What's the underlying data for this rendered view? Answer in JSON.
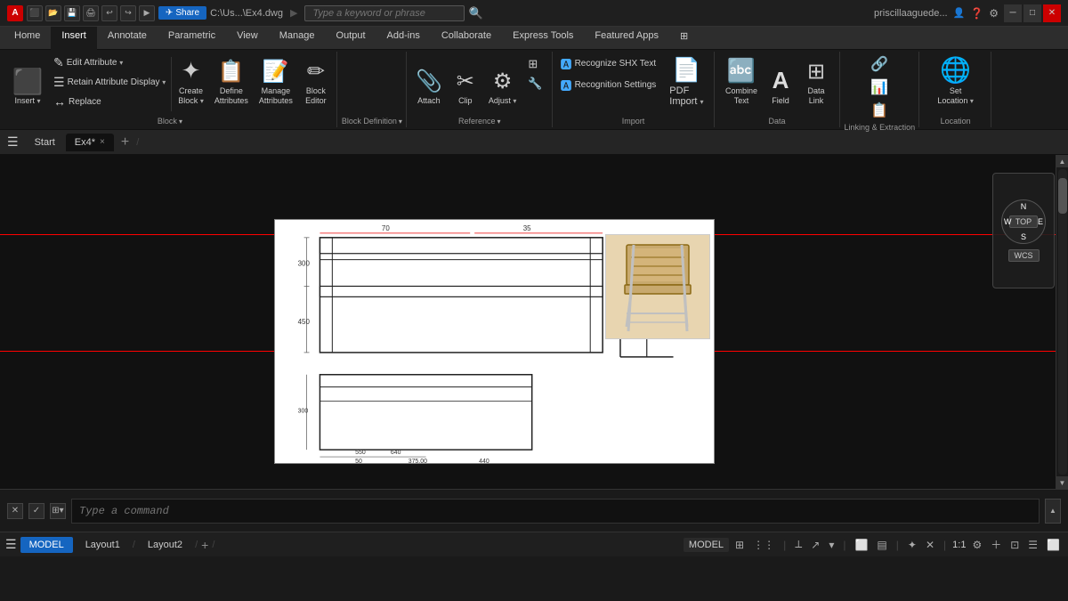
{
  "titlebar": {
    "logo": "A",
    "icons": [
      "⬛",
      "💾",
      "📂",
      "💾",
      "↩",
      "↩",
      "▶",
      "▶"
    ],
    "share_label": "Share",
    "share_icon": "✈",
    "path": "C:\\Us...\\Ex4.dwg",
    "search_placeholder": "Type a keyword or phrase",
    "user": "priscillaaguede...",
    "minimize": "─",
    "maximize": "□",
    "close": "✕"
  },
  "ribbon_tabs": {
    "tabs": [
      "Home",
      "Insert",
      "Annotate",
      "Parametric",
      "View",
      "Manage",
      "Output",
      "Add-ins",
      "Collaborate",
      "Express Tools",
      "Featured Apps",
      "⊞"
    ],
    "active": "Insert"
  },
  "ribbon": {
    "block_group_label": "Block",
    "block_items": [
      {
        "id": "insert",
        "icon": "⬛",
        "label": "Insert",
        "has_dropdown": true
      },
      {
        "id": "create-block",
        "icon": "✦",
        "label": "Create\nBlock",
        "has_dropdown": true
      },
      {
        "id": "define-attrs",
        "icon": "📋",
        "label": "Define\nAttributes"
      },
      {
        "id": "manage-attrs",
        "icon": "📝",
        "label": "Manage\nAttributes"
      },
      {
        "id": "block-editor",
        "icon": "✏",
        "label": "Block\nEditor"
      }
    ],
    "block_small": [
      {
        "id": "edit-attr",
        "icon": "✎",
        "label": "Edit Attribute"
      },
      {
        "id": "retain-attr",
        "icon": "☰",
        "label": "Retain Attribute Display"
      },
      {
        "id": "replace",
        "icon": "↔",
        "label": "Replace"
      }
    ],
    "block_def_label": "Block Definition",
    "reference_group_label": "Reference",
    "reference_items": [
      {
        "id": "attach",
        "icon": "📎",
        "label": "Attach"
      },
      {
        "id": "clip",
        "icon": "✂",
        "label": "Clip"
      },
      {
        "id": "adjust",
        "icon": "⚙",
        "label": "Adjust"
      }
    ],
    "ref_extra_label": "Reference",
    "import_group_label": "Import",
    "import_items": [
      {
        "id": "recognize-shx",
        "icon": "🅰",
        "label": "Recognize SHX Text"
      },
      {
        "id": "recognition-settings",
        "icon": "🅰",
        "label": "Recognition Settings"
      },
      {
        "id": "pdf-import",
        "icon": "📄",
        "label": "PDF\nImport",
        "has_dropdown": true
      }
    ],
    "data_group_label": "Data",
    "data_items": [
      {
        "id": "combine-text",
        "icon": "🔤",
        "label": "Combine\nText"
      },
      {
        "id": "field",
        "icon": "A",
        "label": "Field"
      },
      {
        "id": "data-link",
        "icon": "⊞",
        "label": "Data\nLink"
      }
    ],
    "linking_group_label": "Linking & Extraction",
    "linking_items": [
      {
        "id": "link-extract",
        "icon": "🔗",
        "label": ""
      },
      {
        "id": "link2",
        "icon": "📊",
        "label": ""
      }
    ],
    "location_group_label": "Location",
    "location_items": [
      {
        "id": "set-location",
        "icon": "🌐",
        "label": "Set\nLocation",
        "has_dropdown": true
      }
    ]
  },
  "tabs": {
    "start": "Start",
    "ex4": "Ex4*",
    "close": "×",
    "add": "+"
  },
  "statusbar": {
    "model": "MODEL",
    "layout1": "Layout1",
    "layout2": "Layout2",
    "add": "+",
    "zoom": "1:1"
  },
  "command": {
    "placeholder": "Type a command"
  },
  "navigator": {
    "n": "N",
    "s": "S",
    "e": "E",
    "w": "W",
    "top": "TOP",
    "wcs": "WCS"
  }
}
